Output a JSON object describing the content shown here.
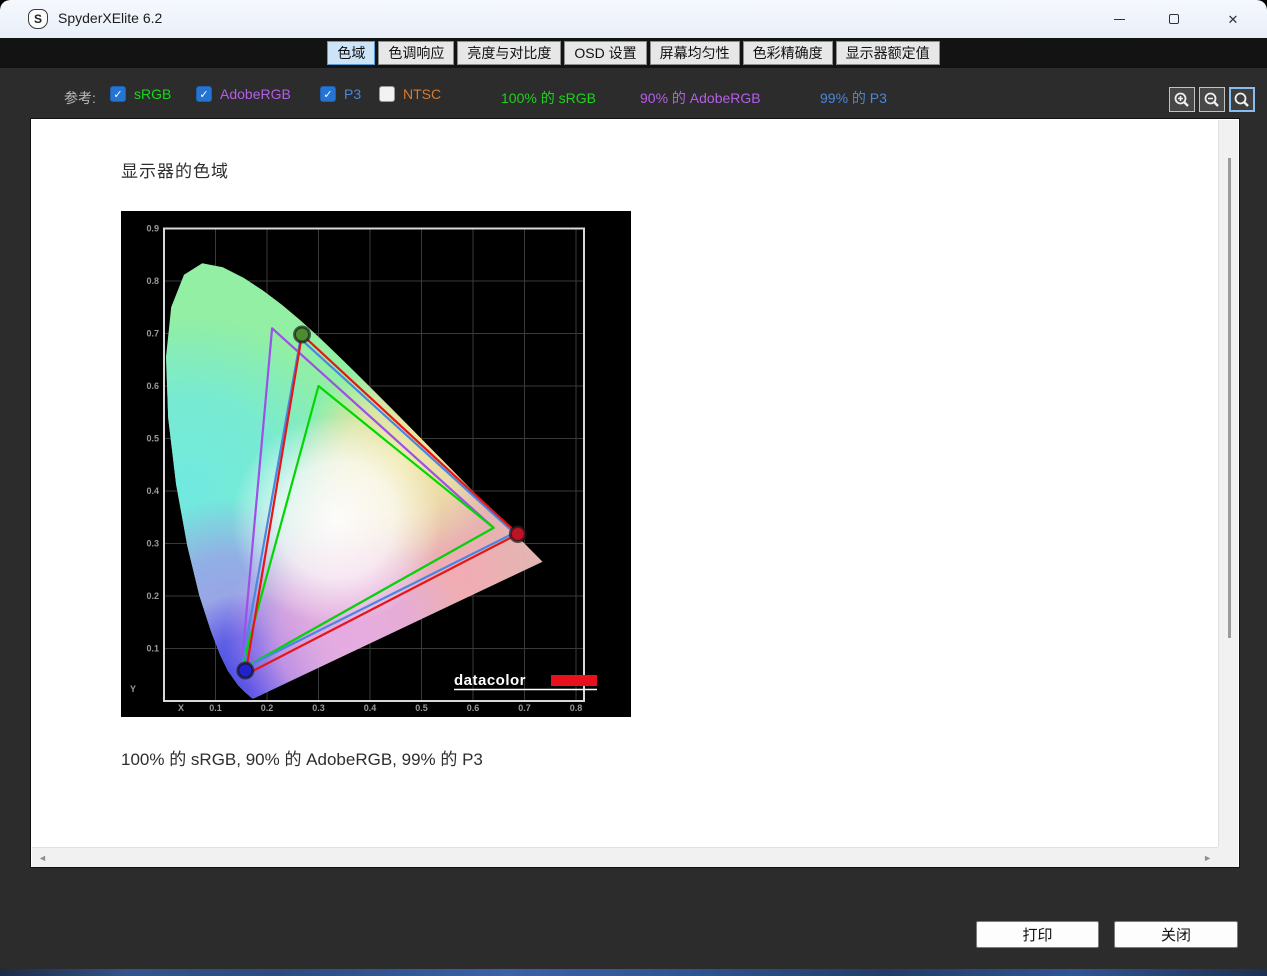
{
  "window": {
    "title": "SpyderXElite 6.2",
    "logo_letter": "S"
  },
  "icons": {
    "close_glyph": "✕",
    "check_glyph": "✓",
    "left_arrow": "◄",
    "right_arrow": "►"
  },
  "tabs": [
    {
      "label": "色域",
      "selected": true
    },
    {
      "label": "色调响应",
      "selected": false
    },
    {
      "label": "亮度与对比度",
      "selected": false
    },
    {
      "label": "OSD 设置",
      "selected": false
    },
    {
      "label": "屏幕均匀性",
      "selected": false
    },
    {
      "label": "色彩精确度",
      "selected": false
    },
    {
      "label": "显示器额定值",
      "selected": false
    }
  ],
  "reference": {
    "label": "参考:",
    "checkboxes": [
      {
        "label": "sRGB",
        "checked": true,
        "color": "#1bd51b"
      },
      {
        "label": "AdobeRGB",
        "checked": true,
        "color": "#b45fe6"
      },
      {
        "label": "P3",
        "checked": true,
        "color": "#4b86d7"
      },
      {
        "label": "NTSC",
        "checked": false,
        "color": "#d8792e"
      }
    ],
    "summaries": [
      {
        "text": "100% 的 sRGB",
        "color": "#1bd51b"
      },
      {
        "text": "90% 的 AdobeRGB",
        "color": "#b45fe6"
      },
      {
        "text": "99% 的 P3",
        "color": "#4b86d7"
      }
    ]
  },
  "zoom_controls": [
    {
      "name": "zoom-in",
      "selected": false
    },
    {
      "name": "zoom-out",
      "selected": false
    },
    {
      "name": "zoom-reset",
      "selected": true
    }
  ],
  "report": {
    "title": "显示器的色域",
    "caption": "100% 的 sRGB, 90% 的 AdobeRGB, 99% 的 P3"
  },
  "buttons": {
    "print": "打印",
    "close": "关闭"
  },
  "chart_data": {
    "type": "chromaticity-diagram",
    "title": "显示器的色域",
    "xlabel": "X",
    "ylabel": "Y",
    "xlim": [
      0,
      0.82
    ],
    "ylim": [
      0,
      0.9
    ],
    "x_ticks": [
      "0.1",
      "0.2",
      "0.3",
      "0.4",
      "0.5",
      "0.6",
      "0.7",
      "0.8"
    ],
    "y_ticks": [
      "0.1",
      "0.2",
      "0.3",
      "0.4",
      "0.5",
      "0.6",
      "0.7",
      "0.8",
      "0.9"
    ],
    "grid": true,
    "logo_text": "datacolor",
    "logo_bar_color": "#e8101c",
    "gamuts": [
      {
        "name": "AdobeRGB",
        "color": "#9e4fe8",
        "points": [
          [
            0.64,
            0.33
          ],
          [
            0.21,
            0.71
          ],
          [
            0.15,
            0.06
          ]
        ]
      },
      {
        "name": "sRGB",
        "color": "#00d800",
        "points": [
          [
            0.64,
            0.33
          ],
          [
            0.3,
            0.6
          ],
          [
            0.15,
            0.06
          ]
        ]
      },
      {
        "name": "P3",
        "color": "#4a86e2",
        "points": [
          [
            0.68,
            0.32
          ],
          [
            0.265,
            0.69
          ],
          [
            0.15,
            0.06
          ]
        ]
      },
      {
        "name": "display",
        "color": "#e51616",
        "points": [
          [
            0.687,
            0.318
          ],
          [
            0.268,
            0.698
          ],
          [
            0.158,
            0.05
          ]
        ]
      }
    ],
    "markers": [
      {
        "name": "green-primary",
        "color": "#4a8c2f",
        "x": 0.268,
        "y": 0.698
      },
      {
        "name": "red-primary",
        "color": "#bf1226",
        "x": 0.687,
        "y": 0.318
      },
      {
        "name": "blue-primary",
        "color": "#2222cc",
        "x": 0.158,
        "y": 0.058
      }
    ],
    "locus": [
      [
        0.1741,
        0.005
      ],
      [
        0.1714,
        0.0051
      ],
      [
        0.1689,
        0.0069
      ],
      [
        0.1644,
        0.0109
      ],
      [
        0.1566,
        0.0177
      ],
      [
        0.144,
        0.0297
      ],
      [
        0.1241,
        0.0578
      ],
      [
        0.1096,
        0.0868
      ],
      [
        0.0913,
        0.1327
      ],
      [
        0.0687,
        0.2007
      ],
      [
        0.0454,
        0.295
      ],
      [
        0.0235,
        0.4127
      ],
      [
        0.0082,
        0.5384
      ],
      [
        0.0039,
        0.6548
      ],
      [
        0.0139,
        0.7502
      ],
      [
        0.0389,
        0.812
      ],
      [
        0.0743,
        0.8338
      ],
      [
        0.1142,
        0.8262
      ],
      [
        0.1547,
        0.8059
      ],
      [
        0.1929,
        0.7816
      ],
      [
        0.2296,
        0.7543
      ],
      [
        0.2658,
        0.7243
      ],
      [
        0.3016,
        0.6923
      ],
      [
        0.3373,
        0.6589
      ],
      [
        0.3731,
        0.6245
      ],
      [
        0.4087,
        0.5896
      ],
      [
        0.4441,
        0.5547
      ],
      [
        0.4788,
        0.5202
      ],
      [
        0.5125,
        0.4866
      ],
      [
        0.5448,
        0.4544
      ],
      [
        0.5752,
        0.4242
      ],
      [
        0.6029,
        0.3965
      ],
      [
        0.627,
        0.3725
      ],
      [
        0.6482,
        0.3514
      ],
      [
        0.6658,
        0.334
      ],
      [
        0.6915,
        0.3083
      ],
      [
        0.7079,
        0.292
      ],
      [
        0.719,
        0.2809
      ],
      [
        0.726,
        0.274
      ],
      [
        0.7347,
        0.2653
      ]
    ]
  }
}
